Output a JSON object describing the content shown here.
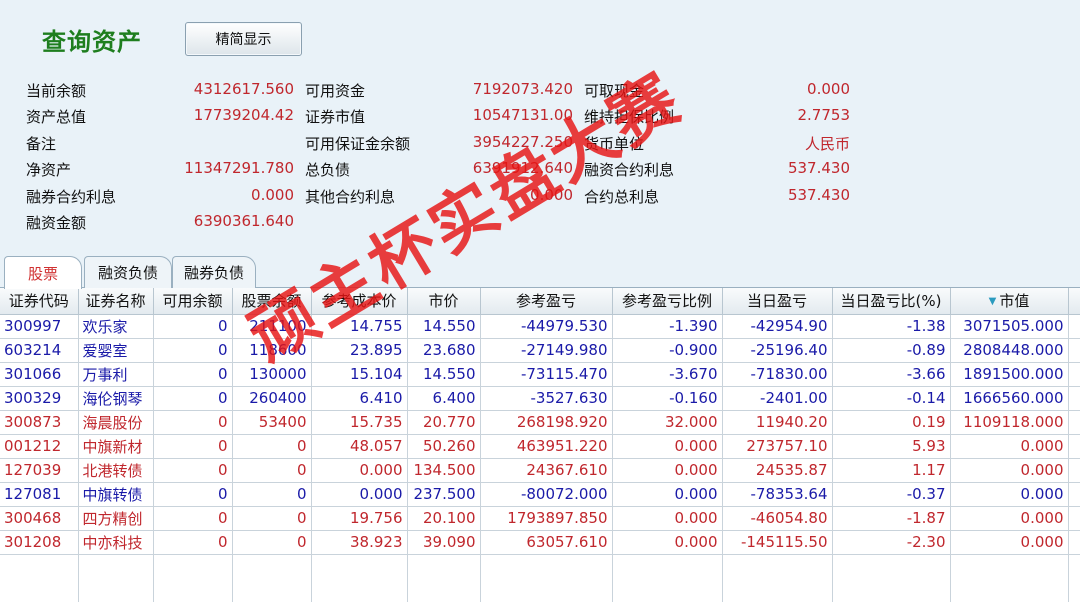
{
  "header": {
    "title": "查询资产",
    "simple_button": "精简显示"
  },
  "summary": [
    {
      "label": "当前余额",
      "value": "4312617.560"
    },
    {
      "label": "可用资金",
      "value": "7192073.420"
    },
    {
      "label": "可取现金",
      "value": "0.000"
    },
    {
      "label": "资产总值",
      "value": "17739204.42"
    },
    {
      "label": "证券市值",
      "value": "10547131.00"
    },
    {
      "label": "维持担保比例",
      "value": "2.7753"
    },
    {
      "label": "备注",
      "value": ""
    },
    {
      "label": "可用保证金余额",
      "value": "3954227.250"
    },
    {
      "label": "货币单位",
      "value": "人民币"
    },
    {
      "label": "净资产",
      "value": "11347291.780"
    },
    {
      "label": "总负债",
      "value": "6391912.640"
    },
    {
      "label": "融资合约利息",
      "value": "537.430"
    },
    {
      "label": "融券合约利息",
      "value": "0.000"
    },
    {
      "label": "其他合约利息",
      "value": "0.000"
    },
    {
      "label": "合约总利息",
      "value": "537.430"
    },
    {
      "label": "融资金额",
      "value": "6390361.640"
    }
  ],
  "tabs": [
    "股票",
    "融资负债",
    "融券负债"
  ],
  "table": {
    "columns": [
      "证券代码",
      "证券名称",
      "可用余额",
      "股票余额",
      "参考成本价",
      "市价",
      "参考盈亏",
      "参考盈亏比例",
      "当日盈亏",
      "当日盈亏比(%)",
      "市值"
    ],
    "rows": [
      {
        "color": "blue",
        "cells": [
          "300997",
          "欢乐家",
          "0",
          "211100",
          "14.755",
          "14.550",
          "-44979.530",
          "-1.390",
          "-42954.90",
          "-1.38",
          "3071505.000"
        ]
      },
      {
        "color": "blue",
        "cells": [
          "603214",
          "爱婴室",
          "0",
          "118600",
          "23.895",
          "23.680",
          "-27149.980",
          "-0.900",
          "-25196.40",
          "-0.89",
          "2808448.000"
        ]
      },
      {
        "color": "blue",
        "cells": [
          "301066",
          "万事利",
          "0",
          "130000",
          "15.104",
          "14.550",
          "-73115.470",
          "-3.670",
          "-71830.00",
          "-3.66",
          "1891500.000"
        ]
      },
      {
        "color": "blue",
        "cells": [
          "300329",
          "海伦钢琴",
          "0",
          "260400",
          "6.410",
          "6.400",
          "-3527.630",
          "-0.160",
          "-2401.00",
          "-0.14",
          "1666560.000"
        ]
      },
      {
        "color": "red",
        "cells": [
          "300873",
          "海晨股份",
          "0",
          "53400",
          "15.735",
          "20.770",
          "268198.920",
          "32.000",
          "11940.20",
          "0.19",
          "1109118.000"
        ]
      },
      {
        "color": "red",
        "cells": [
          "001212",
          "中旗新材",
          "0",
          "0",
          "48.057",
          "50.260",
          "463951.220",
          "0.000",
          "273757.10",
          "5.93",
          "0.000"
        ]
      },
      {
        "color": "red",
        "cells": [
          "127039",
          "北港转债",
          "0",
          "0",
          "0.000",
          "134.500",
          "24367.610",
          "0.000",
          "24535.87",
          "1.17",
          "0.000"
        ]
      },
      {
        "color": "blue",
        "cells": [
          "127081",
          "中旗转债",
          "0",
          "0",
          "0.000",
          "237.500",
          "-80072.000",
          "0.000",
          "-78353.64",
          "-0.37",
          "0.000"
        ]
      },
      {
        "color": "red",
        "cells": [
          "300468",
          "四方精创",
          "0",
          "0",
          "19.756",
          "20.100",
          "1793897.850",
          "0.000",
          "-46054.80",
          "-1.87",
          "0.000"
        ]
      },
      {
        "color": "red",
        "cells": [
          "301208",
          "中亦科技",
          "0",
          "0",
          "38.923",
          "39.090",
          "63057.610",
          "0.000",
          "-145115.50",
          "-2.30",
          "0.000"
        ]
      }
    ]
  },
  "watermark": "顽主杯实盘大赛",
  "colors": {
    "positive": "#c0272d",
    "negative": "#1a1aa8",
    "title": "#1e7e1e",
    "background": "#e9f2f8"
  }
}
